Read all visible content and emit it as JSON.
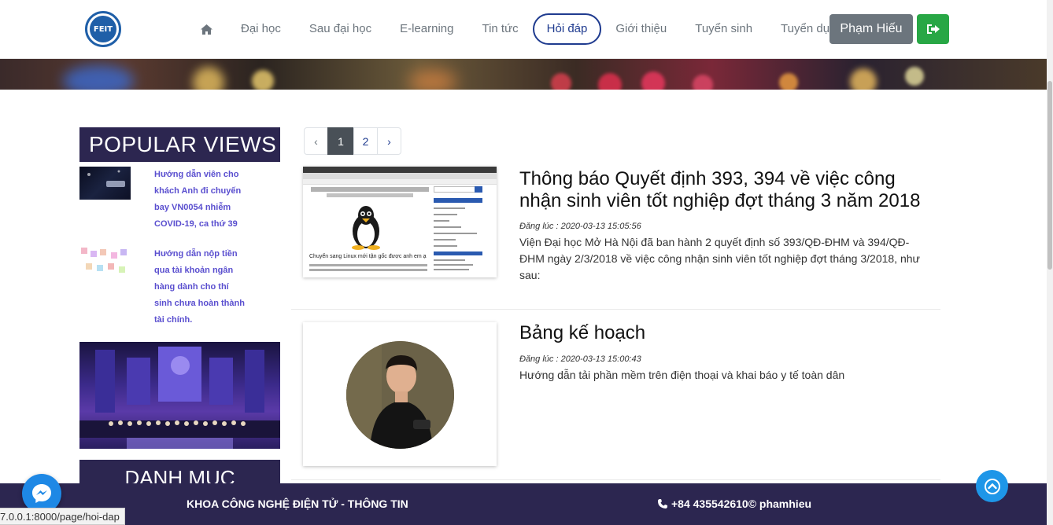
{
  "nav": {
    "logo_text": "FEIT",
    "items": [
      {
        "label": "Đại học"
      },
      {
        "label": "Sau đại học"
      },
      {
        "label": "E-learning"
      },
      {
        "label": "Tin tức"
      },
      {
        "label": "Hỏi đáp",
        "active": true
      },
      {
        "label": "Giới thiệu"
      },
      {
        "label": "Tuyển sinh"
      },
      {
        "label": "Tuyển dụng"
      }
    ],
    "user_name": "Phạm Hiếu"
  },
  "sidebar": {
    "popular_title": "POPULAR VIEWS",
    "popular_items": [
      {
        "title": "Hướng dẫn viên cho khách Anh đi chuyến bay VN0054 nhiễm COVID-19, ca thứ 39"
      },
      {
        "title": "Hướng dẫn nộp tiền qua tài khoản ngân hàng dành cho thí sinh chưa hoàn thành tài chính."
      }
    ],
    "category_title": "DANH MỤC"
  },
  "pagination": {
    "prev": "‹",
    "pages": [
      "1",
      "2"
    ],
    "current": "1",
    "next": "›"
  },
  "posts": [
    {
      "title": "Thông báo Quyết định 393, 394 về việc công nhận sinh viên tốt nghiệp đợt tháng 3 năm 2018",
      "date": "Đăng lúc : 2020-03-13 15:05:56",
      "summary": "Viện Đại học Mở Hà Nội đã ban hành 2 quyết định số 393/QĐ-ĐHM và 394/QĐ-ĐHM ngày 2/3/2018 về việc công nhận sinh viên tốt nghiệp đợt tháng 3/2018, như sau:",
      "thumb_heading": "Chuyển sang Linux mới tận gốc được anh em ạ"
    },
    {
      "title": "Bảng kế hoạch",
      "date": "Đăng lúc : 2020-03-13 15:00:43",
      "summary": "Hướng dẫn tải phần mềm trên điện thoại và khai báo y tế toàn dân"
    }
  ],
  "footer": {
    "left": "KHOA CÔNG NGHỆ ĐIỆN TỬ - THÔNG TIN",
    "right": "+84 435542610© phamhieu"
  },
  "status_url": "7.0.0.1:8000/page/hoi-dap",
  "colors": {
    "primary_dark": "#2c2650",
    "link_purple": "#5a4fcf",
    "nav_active": "#1f3b8f",
    "success": "#28a745",
    "secondary": "#6c757d"
  }
}
